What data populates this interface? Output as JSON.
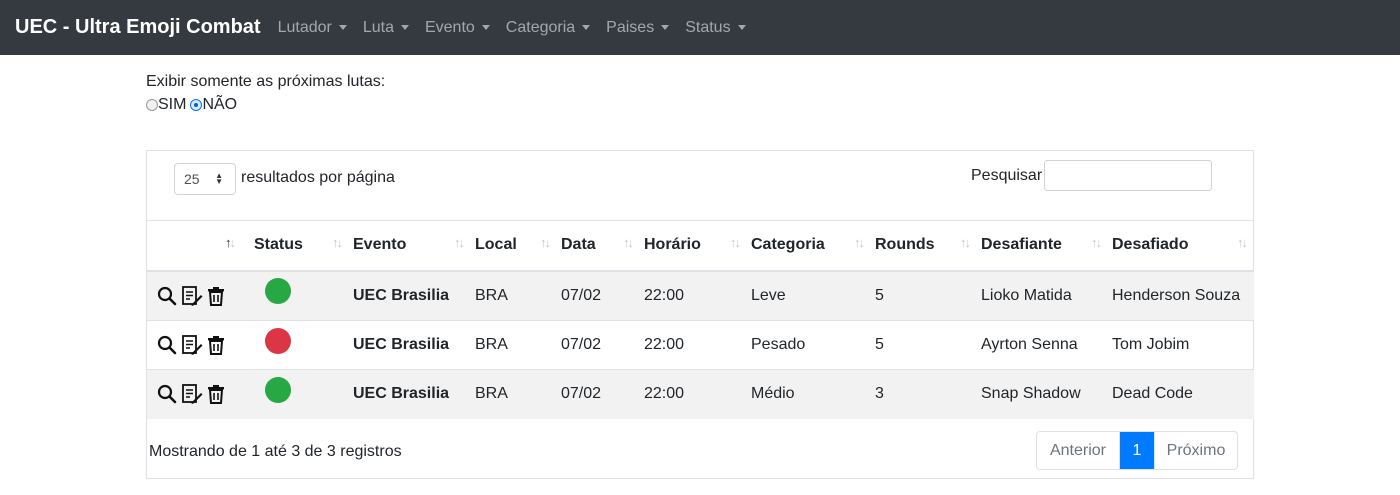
{
  "navbar": {
    "brand": "UEC - Ultra Emoji Combat",
    "items": [
      {
        "label": "Lutador"
      },
      {
        "label": "Luta"
      },
      {
        "label": "Evento"
      },
      {
        "label": "Categoria"
      },
      {
        "label": "Paises"
      },
      {
        "label": "Status"
      }
    ]
  },
  "filter": {
    "label": "Exibir somente as próximas lutas:",
    "options": [
      {
        "label": "SIM",
        "checked": false
      },
      {
        "label": "NÃO",
        "checked": true
      }
    ]
  },
  "table_controls": {
    "page_length_value": "25",
    "page_length_label": "resultados por página",
    "search_label": "Pesquisar",
    "search_value": ""
  },
  "columns": [
    "",
    "Status",
    "Evento",
    "Local",
    "Data",
    "Horário",
    "Categoria",
    "Rounds",
    "Desafiante",
    "Desafiado"
  ],
  "rows": [
    {
      "status_color": "#28a745",
      "evento": "UEC Brasilia",
      "local": "BRA",
      "data": "07/02",
      "horario": "22:00",
      "categoria": "Leve",
      "rounds": "5",
      "desafiante": "Lioko Matida",
      "desafiado": "Henderson Souza"
    },
    {
      "status_color": "#dc3545",
      "evento": "UEC Brasilia",
      "local": "BRA",
      "data": "07/02",
      "horario": "22:00",
      "categoria": "Pesado",
      "rounds": "5",
      "desafiante": "Ayrton Senna",
      "desafiado": "Tom Jobim"
    },
    {
      "status_color": "#28a745",
      "evento": "UEC Brasilia",
      "local": "BRA",
      "data": "07/02",
      "horario": "22:00",
      "categoria": "Médio",
      "rounds": "3",
      "desafiante": "Snap Shadow",
      "desafiado": "Dead Code"
    }
  ],
  "footer": {
    "info": "Mostrando de 1 até 3 de 3 registros",
    "prev": "Anterior",
    "page": "1",
    "next": "Próximo"
  },
  "colors": {
    "navbar": "#343a40",
    "primary": "#007bff",
    "status_ok": "#28a745",
    "status_cancelled": "#dc3545"
  }
}
